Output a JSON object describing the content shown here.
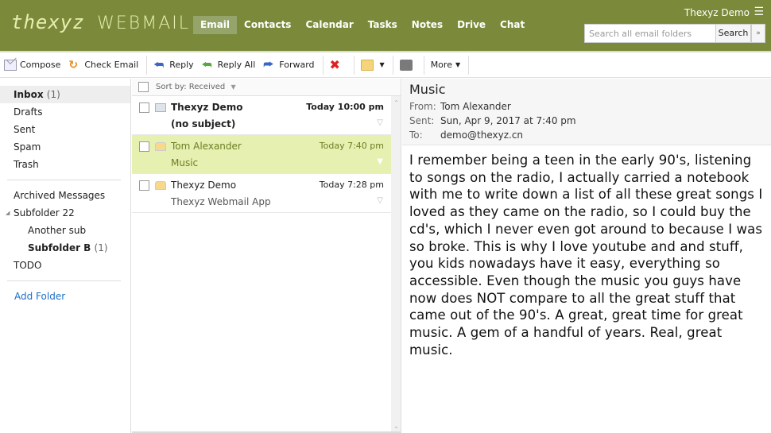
{
  "app": {
    "logo_script": "thexyz",
    "logo_text": "WEBMAIL",
    "user_name": "Thexyz Demo"
  },
  "nav": [
    {
      "label": "Email",
      "active": true
    },
    {
      "label": "Contacts"
    },
    {
      "label": "Calendar"
    },
    {
      "label": "Tasks"
    },
    {
      "label": "Notes"
    },
    {
      "label": "Drive"
    },
    {
      "label": "Chat"
    }
  ],
  "search": {
    "placeholder": "Search all email folders",
    "value": "",
    "button": "Search",
    "more_icon": "double-chevron-down-icon"
  },
  "toolbar": {
    "compose": "Compose",
    "check_email": "Check Email",
    "reply": "Reply",
    "reply_all": "Reply All",
    "forward": "Forward",
    "more": "More"
  },
  "sidebar": {
    "folders": [
      {
        "label": "Inbox",
        "count": "(1)"
      },
      {
        "label": "Drafts"
      },
      {
        "label": "Sent"
      },
      {
        "label": "Spam"
      },
      {
        "label": "Trash"
      }
    ],
    "custom": [
      {
        "label": "Archived Messages"
      },
      {
        "label": "Subfolder 22"
      },
      {
        "label": "Another sub"
      },
      {
        "label": "Subfolder B",
        "count": "(1)"
      },
      {
        "label": "TODO"
      }
    ],
    "add_folder": "Add Folder"
  },
  "list": {
    "sort_label": "Sort by: Received",
    "messages": [
      {
        "from": "Thexyz Demo",
        "subject": "(no subject)",
        "date": "Today 10:00 pm",
        "unread": true
      },
      {
        "from": "Tom Alexander",
        "subject": "Music",
        "date": "Today 7:40 pm",
        "selected": true
      },
      {
        "from": "Thexyz Demo",
        "subject": "Thexyz Webmail App",
        "date": "Today 7:28 pm"
      }
    ]
  },
  "message": {
    "subject": "Music",
    "from_label": "From:",
    "from": "Tom Alexander",
    "sent_label": "Sent:",
    "sent": "Sun, Apr 9, 2017 at 7:40 pm",
    "to_label": "To:",
    "to": "demo@thexyz.cn",
    "body": "I remember being a teen in the early 90's, listening to songs on the radio, I actually carried a notebook with me to write down a list of all these great songs I loved as they came on the radio, so I could buy the cd's, which I never even got around to because I was so broke.  This is why I love youtube and and stuff, you kids nowadays have it easy, everything so accessible.  Even though the music you guys have now does NOT compare to all the great stuff that came out of the 90's.  A great, great time for great music.  A gem of a handful of years.  Real, great music."
  }
}
